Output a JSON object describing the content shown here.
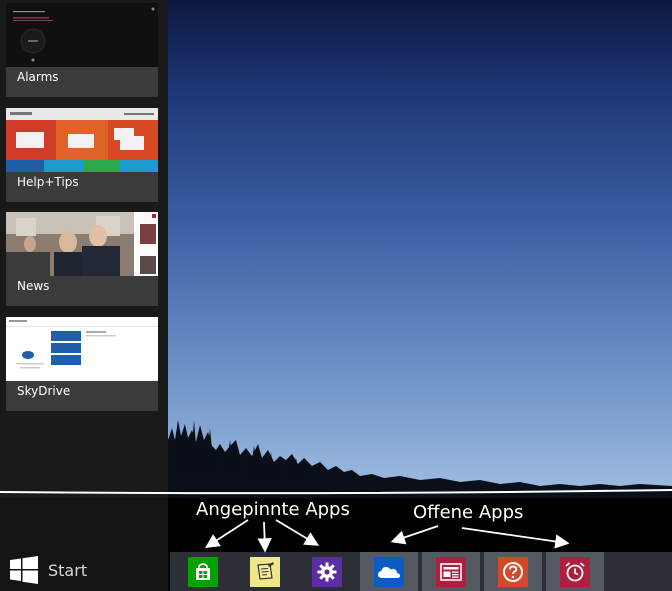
{
  "switcher": {
    "apps": [
      {
        "label": "Alarms"
      },
      {
        "label": "Help+Tips"
      },
      {
        "label": "News"
      },
      {
        "label": "SkyDrive"
      }
    ]
  },
  "start": {
    "label": "Start"
  },
  "annotations": {
    "pinned": "Angepinnte Apps",
    "open": "Offene Apps"
  },
  "taskbar": {
    "pinned": [
      {
        "icon": "store-icon",
        "color": "#00a300"
      },
      {
        "icon": "notes-icon",
        "color": "#f0e68c"
      },
      {
        "icon": "gear-icon",
        "color": "#5b2ea6"
      }
    ],
    "open": [
      {
        "icon": "skydrive-cloud-icon",
        "color": "#0a5bc4"
      },
      {
        "icon": "news-icon",
        "color": "#b01e3f"
      },
      {
        "icon": "help-icon",
        "color": "#d4492a"
      },
      {
        "icon": "alarm-clock-icon",
        "color": "#b01e3f"
      }
    ]
  },
  "colors": {
    "taskbar_bg": "#000000",
    "switcher_bg": "#191919",
    "open_tile_bg": "#555a62"
  }
}
